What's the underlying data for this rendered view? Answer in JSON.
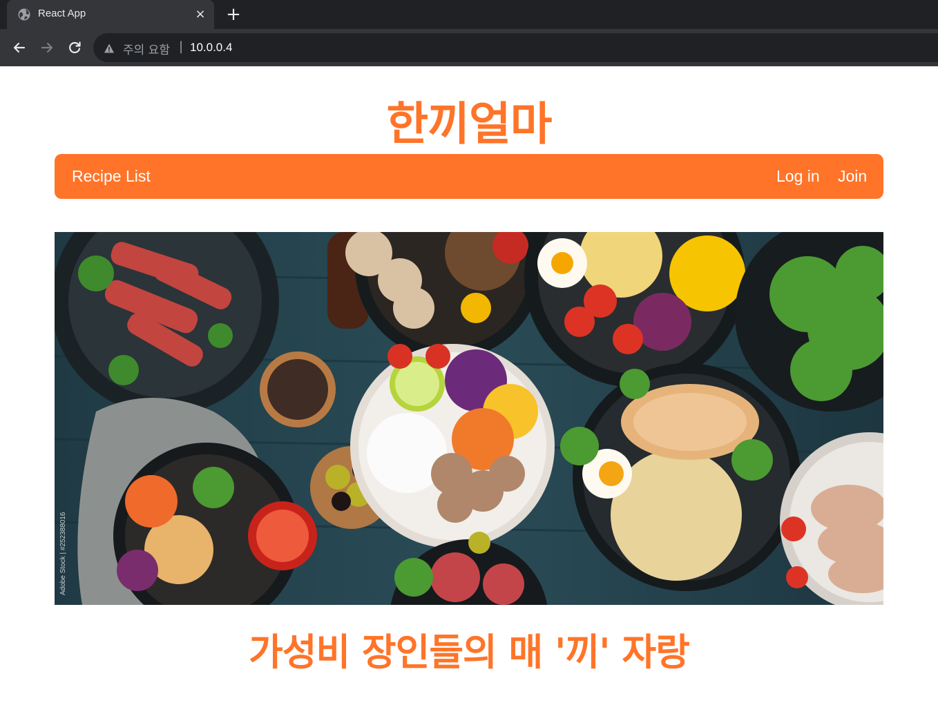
{
  "browser": {
    "tab_title": "React App",
    "tab_close": "×",
    "new_tab": "+",
    "security_label": "주의 요함",
    "url_separator": "|",
    "url": "10.0.0.4"
  },
  "header": {
    "site_title": "한끼얼마"
  },
  "navbar": {
    "recipe_list": "Recipe List",
    "login": "Log in",
    "join": "Join"
  },
  "hero": {
    "watermark": "Adobe Stock | #252388016"
  },
  "main": {
    "tagline": "가성비 장인들의 매 '끼' 자랑"
  },
  "colors": {
    "brand": "#ff7428",
    "chrome_dark": "#202124",
    "chrome_mid": "#35363a"
  }
}
